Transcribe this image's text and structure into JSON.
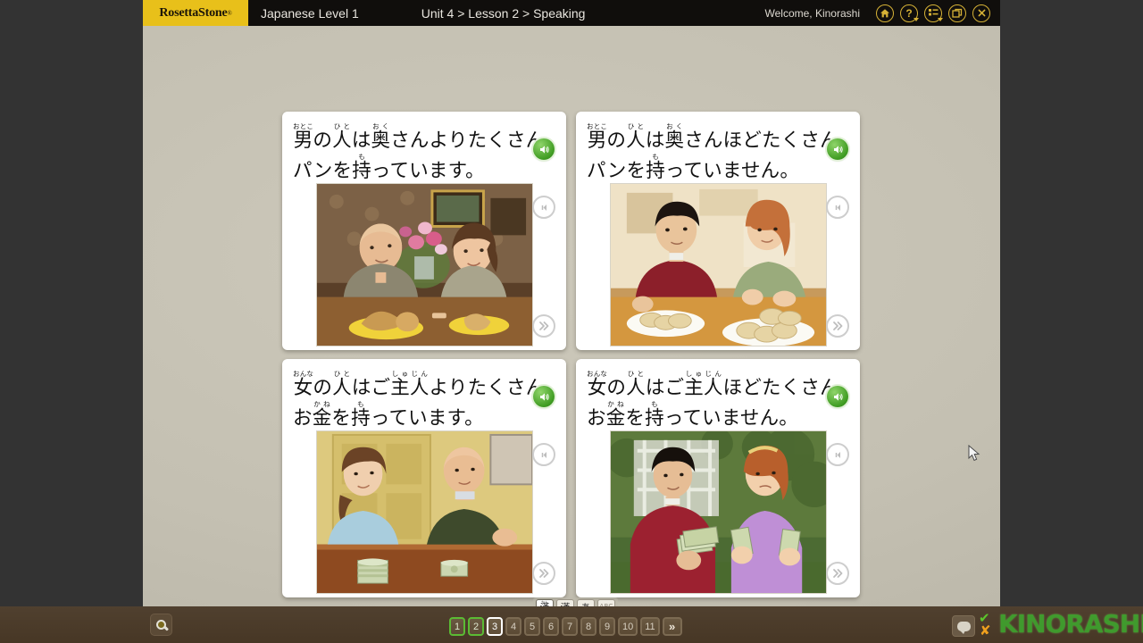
{
  "header": {
    "logo_text": "RosettaStone",
    "logo_reg": "®",
    "course_title": "Japanese Level 1",
    "breadcrumb": "Unit 4 > Lesson 2 > Speaking",
    "welcome": "Welcome, Kinorashi",
    "icons": [
      {
        "name": "home-icon",
        "label": "Home"
      },
      {
        "name": "help-icon",
        "label": "Help"
      },
      {
        "name": "menu-icon",
        "label": "Menu"
      },
      {
        "name": "window-icon",
        "label": "Window"
      },
      {
        "name": "close-icon",
        "label": "Close"
      }
    ],
    "accent_yellow": "#e8c01a",
    "bar_color": "#100e0c"
  },
  "cards": [
    {
      "id": "card-1",
      "line1": "男の人は奥さんよりたくさん",
      "line2": "パンを持っています。",
      "line1_plain": "男の人は奥さんよりたくさん",
      "line2_plain": "パンを持っています。",
      "furigana_line1": [
        "おとこ",
        "ひと",
        "おく"
      ],
      "furigana_line2": [
        "も"
      ],
      "photo_alt": "Bald man in olive shirt and woman in grey sweater at a table with two yellow plates of bread",
      "speaker_state": "active"
    },
    {
      "id": "card-2",
      "line1": "男の人は奥さんほどたくさん",
      "line2": "パンを持っていません。",
      "furigana_line1": [
        "おとこ",
        "ひと",
        "おく"
      ],
      "furigana_line2": [
        "も"
      ],
      "photo_alt": "Man in red sweater and woman in green at a table with plates of sliced bread",
      "speaker_state": "active"
    },
    {
      "id": "card-3",
      "line1": "女の人はご主人よりたくさん",
      "line2": "お金を持っています。",
      "furigana_line1": [
        "おんな",
        "ひと",
        "しゅじん"
      ],
      "furigana_line2": [
        "かね",
        "も"
      ],
      "photo_alt": "Woman in light blue top and bald man in dark green sweater at a wooden table with stacks of cash",
      "speaker_state": "active"
    },
    {
      "id": "card-4",
      "line1": "女の人はご主人ほどたくさん",
      "line2": "お金を持っていません。",
      "furigana_line1": [
        "おんな",
        "ひと",
        "しゅじん"
      ],
      "furigana_line2": [
        "かね",
        "も"
      ],
      "photo_alt": "Man in red shirt holding a handful of bills beside a woman in purple holding two bills outdoors",
      "speaker_state": "active"
    }
  ],
  "card_controls": {
    "speaker_name": "play-audio-button",
    "prev_name": "replay-audio-button",
    "next_name": "next-button"
  },
  "script_toggle": {
    "buttons": [
      {
        "name": "script-kanji-furigana",
        "glyph": "漢",
        "ruby": "かん",
        "selected": true
      },
      {
        "name": "script-kanji",
        "glyph": "漢",
        "selected": false
      },
      {
        "name": "script-hiragana",
        "glyph": "あ",
        "selected": false
      },
      {
        "name": "script-romaji",
        "glyph": "ABC",
        "selected": false
      }
    ]
  },
  "bottom": {
    "search_label": "Search",
    "pages": [
      {
        "n": "1",
        "state": "done"
      },
      {
        "n": "2",
        "state": "done"
      },
      {
        "n": "3",
        "state": "current"
      },
      {
        "n": "4",
        "state": "normal"
      },
      {
        "n": "5",
        "state": "normal"
      },
      {
        "n": "6",
        "state": "normal"
      },
      {
        "n": "7",
        "state": "normal"
      },
      {
        "n": "8",
        "state": "normal"
      },
      {
        "n": "9",
        "state": "normal"
      },
      {
        "n": "10",
        "state": "normal"
      },
      {
        "n": "11",
        "state": "normal"
      }
    ],
    "more_label": "»",
    "check_mark": "✔",
    "x_mark": "✘",
    "bubble_label": "Feedback",
    "watermark": "KINORASHI",
    "watermark_color": "#3fa32e",
    "bar_color": "#4a3a27"
  },
  "colors": {
    "letterbox": "#333333",
    "stage": "#c6c2b4",
    "card": "#ffffff",
    "speaker_green": "#3f9c22",
    "page_done_green": "#5bbb34"
  }
}
